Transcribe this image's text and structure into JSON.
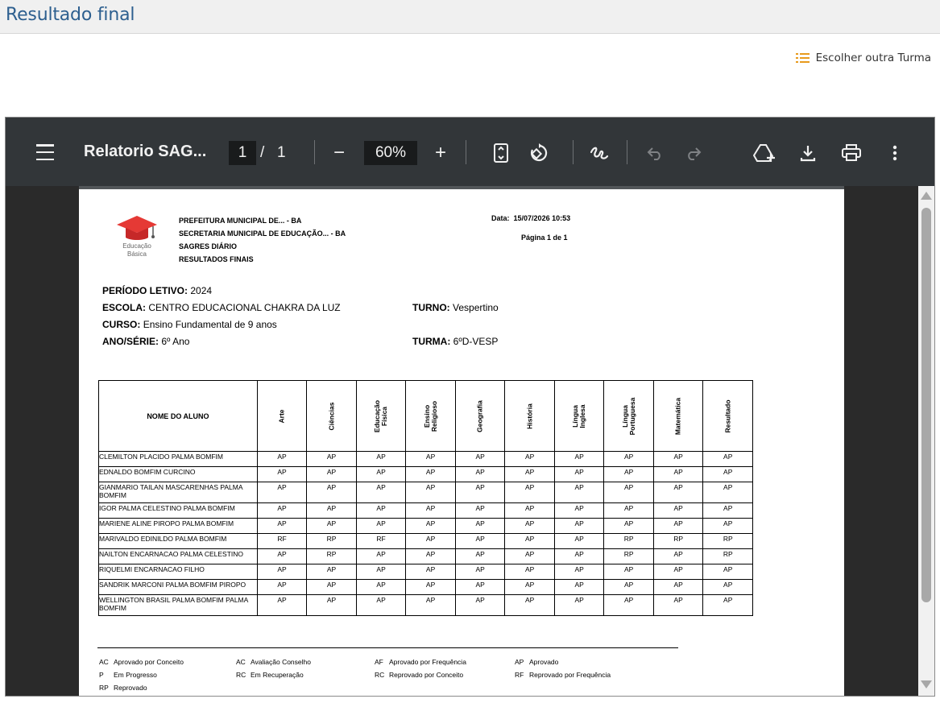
{
  "page": {
    "title": "Resultado final",
    "choose_label": "Escolher outra Turma"
  },
  "viewer": {
    "doc_title": "Relatorio SAG...",
    "current_page": "1",
    "page_separator": "/",
    "total_pages": "1",
    "zoom": "60%",
    "zoom_out_symbol": "−",
    "zoom_in_symbol": "+"
  },
  "report": {
    "logo_text_1": "Educação",
    "logo_text_2": "Básica",
    "header_lines": [
      "PREFEITURA MUNICIPAL DE... - BA",
      "SECRETARIA MUNICIPAL DE EDUCAÇÃO... - BA",
      "SAGRES DIÁRIO",
      "RESULTADOS FINAIS"
    ],
    "date_label": "Data:",
    "date_value": "15/07/2026 10:53",
    "page_label": "Página 1 de 1",
    "periodo_label": "PERÍODO LETIVO:",
    "periodo_value": "2024",
    "escola_label": "ESCOLA:",
    "escola_value": "CENTRO EDUCACIONAL CHAKRA DA LUZ",
    "turno_label": "TURNO:",
    "turno_value": "Vespertino",
    "curso_label": "CURSO:",
    "curso_value": "Ensino Fundamental de 9 anos",
    "serie_label": "ANO/SÉRIE:",
    "serie_value": "6º Ano",
    "turma_label": "TURMA:",
    "turma_value": "6ºD-VESP",
    "name_header": "NOME DO ALUNO",
    "subjects": [
      "Arte",
      "Ciências",
      "Educação\nFísica",
      "Ensino\nReligioso",
      "Geografia",
      "História",
      "Língua\nInglesa",
      "Língua\nPortuguesa",
      "Matemática",
      "Resultado"
    ],
    "students": [
      {
        "name": "CLEMILTON PLACIDO PALMA BOMFIM",
        "grades": [
          "AP",
          "AP",
          "AP",
          "AP",
          "AP",
          "AP",
          "AP",
          "AP",
          "AP",
          "AP"
        ]
      },
      {
        "name": "EDNALDO BOMFIM CURCINO",
        "grades": [
          "AP",
          "AP",
          "AP",
          "AP",
          "AP",
          "AP",
          "AP",
          "AP",
          "AP",
          "AP"
        ]
      },
      {
        "name": "GIANMARIO TAILAN MASCARENHAS PALMA BOMFIM",
        "grades": [
          "AP",
          "AP",
          "AP",
          "AP",
          "AP",
          "AP",
          "AP",
          "AP",
          "AP",
          "AP"
        ]
      },
      {
        "name": "IGOR PALMA CELESTINO PALMA BOMFIM",
        "grades": [
          "AP",
          "AP",
          "AP",
          "AP",
          "AP",
          "AP",
          "AP",
          "AP",
          "AP",
          "AP"
        ]
      },
      {
        "name": "MARIENE ALINE PIROPO PALMA BOMFIM",
        "grades": [
          "AP",
          "AP",
          "AP",
          "AP",
          "AP",
          "AP",
          "AP",
          "AP",
          "AP",
          "AP"
        ]
      },
      {
        "name": "MARIVALDO EDINILDO PALMA BOMFIM",
        "grades": [
          "RF",
          "RP",
          "RF",
          "AP",
          "AP",
          "AP",
          "AP",
          "RP",
          "RP",
          "RP"
        ]
      },
      {
        "name": "NAILTON ENCARNACAO PALMA CELESTINO",
        "grades": [
          "AP",
          "RP",
          "AP",
          "AP",
          "AP",
          "AP",
          "AP",
          "RP",
          "AP",
          "RP"
        ]
      },
      {
        "name": "RIQUELMI ENCARNACAO FILHO",
        "grades": [
          "AP",
          "AP",
          "AP",
          "AP",
          "AP",
          "AP",
          "AP",
          "AP",
          "AP",
          "AP"
        ]
      },
      {
        "name": "SANDRIK MARCONI PALMA BOMFIM PIROPO",
        "grades": [
          "AP",
          "AP",
          "AP",
          "AP",
          "AP",
          "AP",
          "AP",
          "AP",
          "AP",
          "AP"
        ]
      },
      {
        "name": "WELLINGTON BRASIL PALMA BOMFIM PALMA BOMFIM",
        "grades": [
          "AP",
          "AP",
          "AP",
          "AP",
          "AP",
          "AP",
          "AP",
          "AP",
          "AP",
          "AP"
        ]
      }
    ],
    "legend": [
      {
        "code": "AC",
        "text": "Aprovado por Conceito"
      },
      {
        "code": "AC",
        "text": "Avaliação Conselho"
      },
      {
        "code": "AF",
        "text": "Aprovado por Frequência"
      },
      {
        "code": "AP",
        "text": "Aprovado"
      },
      {
        "code": "P",
        "text": "Em Progresso"
      },
      {
        "code": "RC",
        "text": "Em Recuperação"
      },
      {
        "code": "RC",
        "text": "Reprovado por Conceito"
      },
      {
        "code": "RF",
        "text": "Reprovado por Frequência"
      },
      {
        "code": "RP",
        "text": "Reprovado"
      }
    ]
  },
  "colors": {
    "title": "#2d5f8f",
    "list_icon": "#e89a1c",
    "toolbar": "#323639",
    "logo_red": "#e53935"
  }
}
